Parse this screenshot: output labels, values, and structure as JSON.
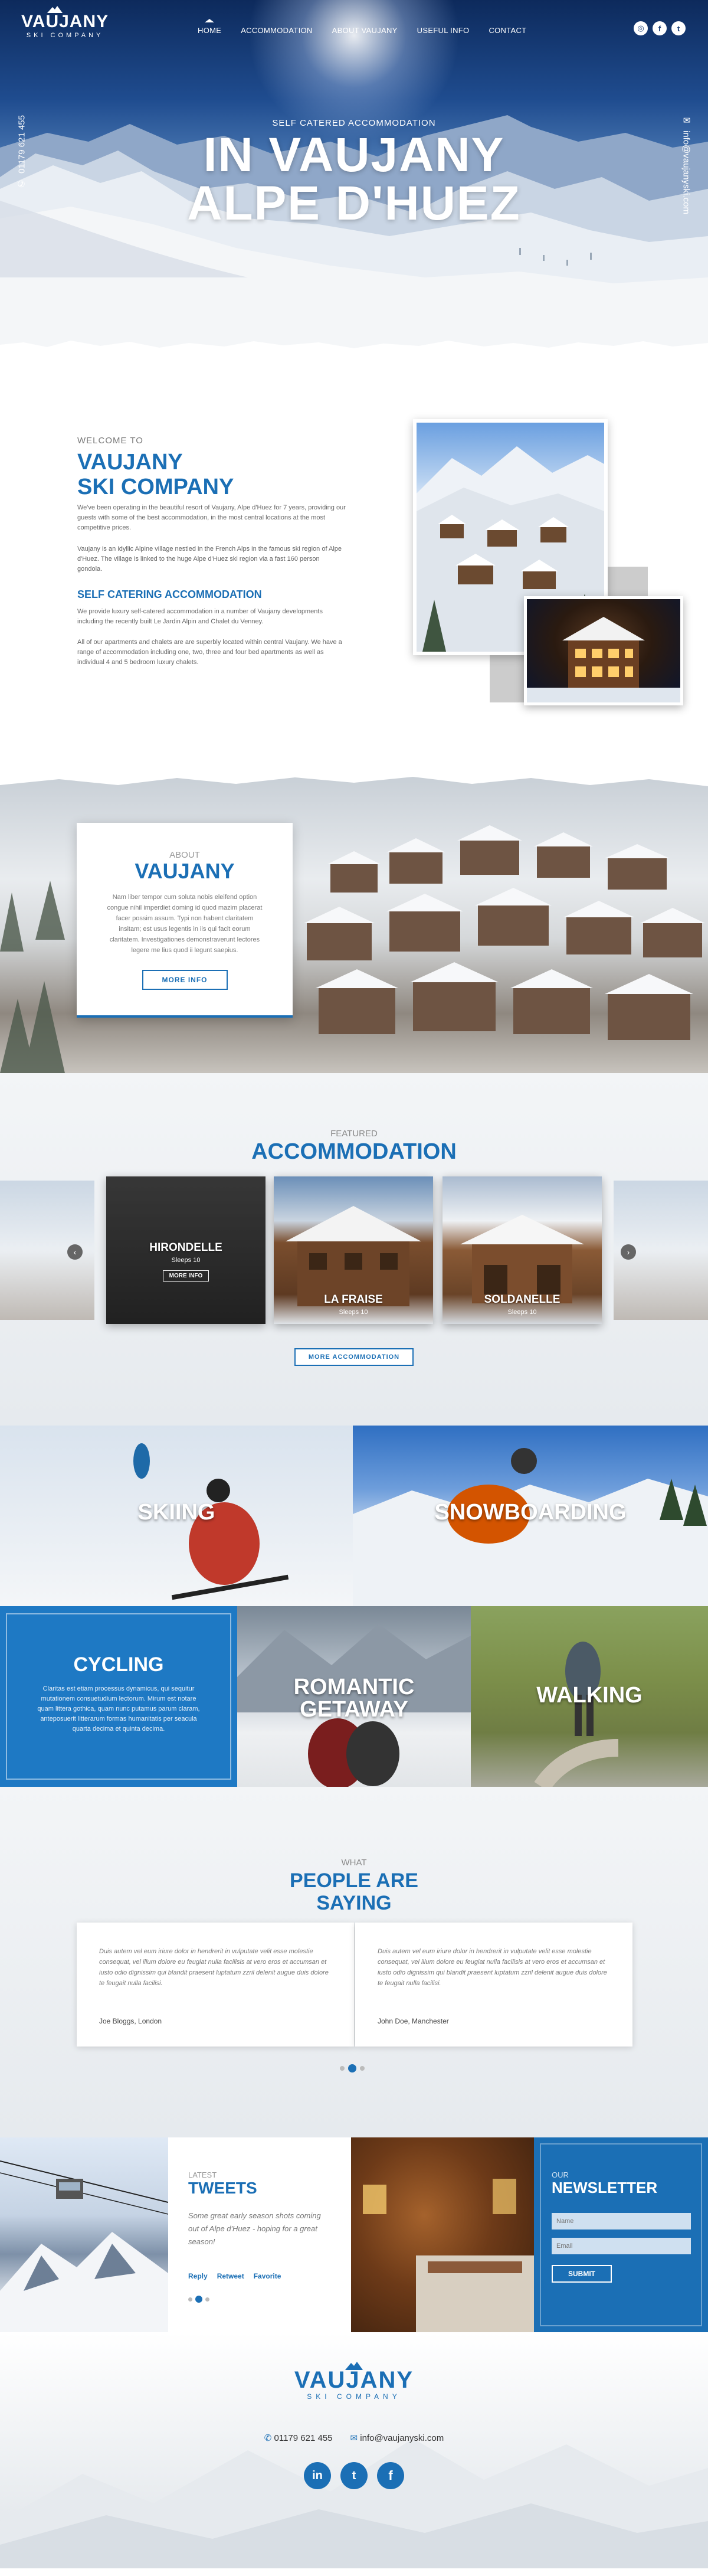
{
  "brand": {
    "name": "VAUJANY",
    "sub": "SKI COMPANY"
  },
  "nav": [
    {
      "label": "HOME"
    },
    {
      "label": "ACCOMMODATION"
    },
    {
      "label": "ABOUT VAUJANY"
    },
    {
      "label": "USEFUL INFO"
    },
    {
      "label": "CONTACT"
    }
  ],
  "social": {
    "top": [
      "tripadvisor-icon",
      "facebook-icon",
      "twitter-icon"
    ],
    "footer": [
      "linkedin-icon",
      "twitter-icon",
      "facebook-icon"
    ]
  },
  "hero": {
    "tagline": "SELF CATERED ACCOMMODATION",
    "title_line1": "IN VAUJANY",
    "title_line2": "ALPE D'HUEZ",
    "phone": "01179 621 455",
    "email": "info@vaujanyski.com"
  },
  "welcome": {
    "pre": "WELCOME TO",
    "title_line1": "VAUJANY",
    "title_line2": "SKI COMPANY",
    "p1": "We've been operating in the beautiful resort of Vaujany, Alpe d'Huez for 7 years, providing our guests with some of the best accommodation, in the most central locations at the most competitive prices.",
    "p2": "Vaujany is an idyllic Alpine village nestled in the French Alps in the famous ski region of Alpe d'Huez. The village is linked to the huge Alpe d'Huez ski region via a fast 160 person gondola.",
    "subtitle": "SELF CATERING ACCOMMODATION",
    "p3": "We provide luxury self-catered accommodation in a number of Vaujany developments including the recently built Le Jardin Alpin and Chalet du Venney.",
    "p4": "All of our apartments and chalets are are superbly located within central Vaujany. We have a range of accommodation including one, two, three and four bed apartments as well as individual 4 and 5 bedroom luxury chalets."
  },
  "about": {
    "pre": "ABOUT",
    "title": "VAUJANY",
    "text": "Nam liber tempor cum soluta nobis eleifend option congue nihil imperdiet doming id quod mazim placerat facer possim assum. Typi non habent claritatem insitam; est usus legentis in iis qui facit eorum claritatem. Investigationes demonstraverunt lectores legere me lius quod ii legunt saepius.",
    "button": "MORE INFO"
  },
  "accommodation": {
    "pre": "FEATURED",
    "title": "ACCOMMODATION",
    "cards": [
      {
        "name": "HIRONDELLE",
        "sleeps": "Sleeps 10",
        "button": "MORE INFO"
      },
      {
        "name": "LA FRAISE",
        "sleeps": "Sleeps 10"
      },
      {
        "name": "SOLDANELLE",
        "sleeps": "Sleeps 10"
      }
    ],
    "button": "MORE ACCOMMODATION"
  },
  "activities": {
    "skiing": "SKIING",
    "snowboarding": "SNOWBOARDING",
    "cycling": "CYCLING",
    "cycling_text": "Claritas est etiam processus dynamicus, qui sequitur mutationem consuetudium lectorum. Mirum est notare quam littera gothica, quam nunc putamus parum claram, anteposuerit litterarum formas humanitatis per seacula quarta decima et quinta decima.",
    "romantic_line1": "ROMANTIC",
    "romantic_line2": "GETAWAY",
    "walking": "WALKING"
  },
  "testimonials": {
    "pre": "WHAT",
    "title_line1": "PEOPLE ARE",
    "title_line2": "SAYING",
    "items": [
      {
        "text": "Duis autem vel eum iriure dolor in hendrerit in vulputate velit esse molestie consequat, vel illum dolore eu feugiat nulla facilisis at vero eros et accumsan et iusto odio dignissim qui blandit praesent luptatum zzril delenit augue duis dolore te feugait nulla facilisi.",
        "author": "Joe Bloggs, London"
      },
      {
        "text": "Duis autem vel eum iriure dolor in hendrerit in vulputate velit esse molestie consequat, vel illum dolore eu feugiat nulla facilisis at vero eros et accumsan et iusto odio dignissim qui blandit praesent luptatum zzril delenit augue duis dolore te feugait nulla facilisi.",
        "author": "John Doe, Manchester"
      }
    ]
  },
  "tweets": {
    "pre": "LATEST",
    "title": "TWEETS",
    "text": "Some great early season shots coming out of Alpe d'Huez - hoping for a great season!",
    "actions": [
      "Reply",
      "Retweet",
      "Favorite"
    ]
  },
  "newsletter": {
    "pre": "OUR",
    "title": "NEWSLETTER",
    "name_placeholder": "Name",
    "email_placeholder": "Email",
    "button": "SUBMIT"
  },
  "footer": {
    "phone": "01179 621 455",
    "email": "info@vaujanyski.com"
  },
  "colors": {
    "brand_blue": "#1b6fb5",
    "dark_blue": "#0e3f7a"
  }
}
